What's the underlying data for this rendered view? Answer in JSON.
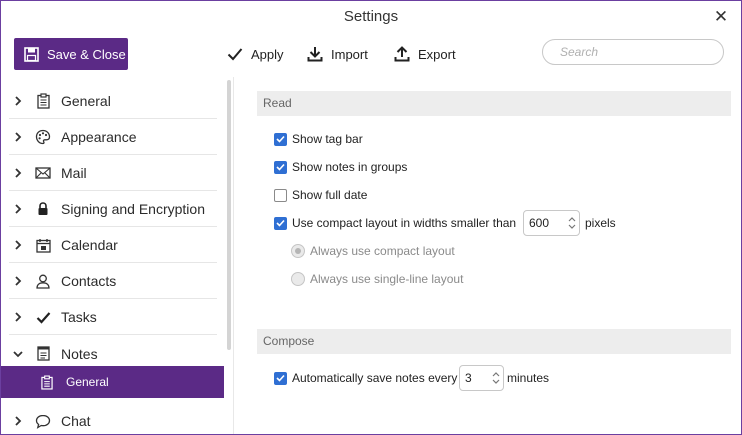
{
  "window": {
    "title": "Settings"
  },
  "toolbar": {
    "save_close": "Save & Close",
    "apply": "Apply",
    "import": "Import",
    "export": "Export",
    "search_placeholder": "Search"
  },
  "sidebar": {
    "items": [
      {
        "label": "General",
        "icon": "clipboard-icon",
        "expanded": false
      },
      {
        "label": "Appearance",
        "icon": "palette-icon",
        "expanded": false
      },
      {
        "label": "Mail",
        "icon": "envelope-icon",
        "expanded": false
      },
      {
        "label": "Signing and Encryption",
        "icon": "lock-icon",
        "expanded": false
      },
      {
        "label": "Calendar",
        "icon": "calendar-icon",
        "expanded": false
      },
      {
        "label": "Contacts",
        "icon": "person-icon",
        "expanded": false
      },
      {
        "label": "Tasks",
        "icon": "checkmark-icon",
        "expanded": false
      },
      {
        "label": "Notes",
        "icon": "notes-icon",
        "expanded": true
      },
      {
        "label": "Chat",
        "icon": "chat-bubble-icon",
        "expanded": false
      }
    ],
    "subitem": {
      "label": "General",
      "icon": "clipboard-icon",
      "selected": true
    }
  },
  "read": {
    "header": "Read",
    "show_tag_bar": {
      "label": "Show tag bar",
      "checked": true
    },
    "show_notes_in_groups": {
      "label": "Show notes in groups",
      "checked": true
    },
    "show_full_date": {
      "label": "Show full date",
      "checked": false
    },
    "compact_layout": {
      "label": "Use compact layout in widths smaller than",
      "checked": true,
      "value": "600",
      "unit": "pixels"
    },
    "radio_compact": {
      "label": "Always use compact layout",
      "selected": true,
      "disabled": true
    },
    "radio_single": {
      "label": "Always use single-line layout",
      "selected": false,
      "disabled": true
    }
  },
  "compose": {
    "header": "Compose",
    "autosave": {
      "label": "Automatically save notes every",
      "checked": true,
      "value": "3",
      "unit": "minutes"
    }
  },
  "colors": {
    "accent": "#5b2a86",
    "checkbox": "#2f6fd3"
  }
}
